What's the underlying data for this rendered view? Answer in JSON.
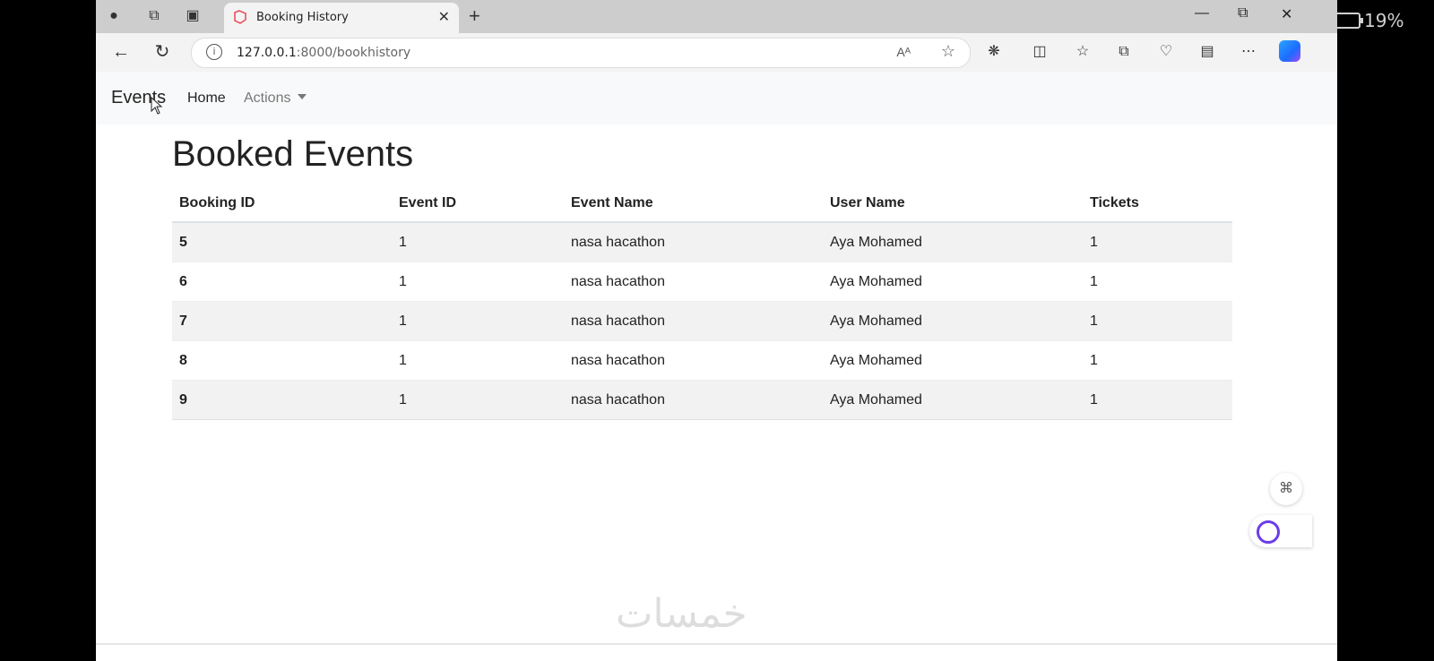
{
  "browser": {
    "tab_title": "Booking History",
    "url_host": "127.0.0.1",
    "url_path": ":8000/bookhistory",
    "read_aloud_label": "Aᴬ"
  },
  "phone_status": {
    "battery": "19%"
  },
  "navbar": {
    "brand": "Events",
    "home": "Home",
    "actions": "Actions"
  },
  "page": {
    "title": "Booked Events",
    "table": {
      "headers": [
        "Booking ID",
        "Event ID",
        "Event Name",
        "User Name",
        "Tickets"
      ],
      "rows": [
        [
          "5",
          "1",
          "nasa hacathon",
          "Aya Mohamed",
          "1"
        ],
        [
          "6",
          "1",
          "nasa hacathon",
          "Aya Mohamed",
          "1"
        ],
        [
          "7",
          "1",
          "nasa hacathon",
          "Aya Mohamed",
          "1"
        ],
        [
          "8",
          "1",
          "nasa hacathon",
          "Aya Mohamed",
          "1"
        ],
        [
          "9",
          "1",
          "nasa hacathon",
          "Aya Mohamed",
          "1"
        ]
      ]
    }
  },
  "watermark": "خمسات",
  "colors": {
    "background": "#ffffff",
    "navbar": "#f8f9fa",
    "striped_row": "#f2f2f2",
    "tab_favicon": "#e8505b"
  }
}
